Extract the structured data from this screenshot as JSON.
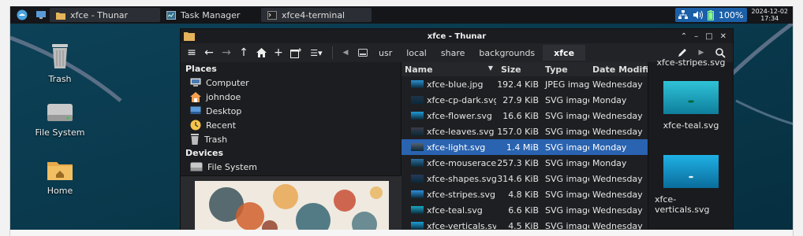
{
  "panel": {
    "tasks": [
      {
        "label": "xfce - Thunar",
        "icon": "folder-icon"
      },
      {
        "label": "Task Manager",
        "icon": "task-manager-icon"
      },
      {
        "label": "xfce4-terminal",
        "icon": "terminal-icon"
      }
    ],
    "battery": "100%",
    "date": "2024-12-02",
    "time": "17:34"
  },
  "desktop": {
    "icons": [
      {
        "label": "Trash",
        "icon": "trash-icon"
      },
      {
        "label": "File System",
        "icon": "drive-icon"
      },
      {
        "label": "Home",
        "icon": "home-folder-icon"
      }
    ]
  },
  "window": {
    "title": "xfce - Thunar",
    "breadcrumbs": [
      "usr",
      "local",
      "share",
      "backgrounds",
      "xfce"
    ],
    "active_crumb": "xfce"
  },
  "sidebar": {
    "places_heading": "Places",
    "places": [
      {
        "label": "Computer",
        "icon": "computer-icon"
      },
      {
        "label": "johndoe",
        "icon": "home-icon"
      },
      {
        "label": "Desktop",
        "icon": "desktop-icon"
      },
      {
        "label": "Recent",
        "icon": "recent-icon"
      },
      {
        "label": "Trash",
        "icon": "trash-icon"
      }
    ],
    "devices_heading": "Devices",
    "devices": [
      {
        "label": "File System",
        "icon": "drive-icon"
      }
    ]
  },
  "list": {
    "columns": [
      "Name",
      "Size",
      "Type",
      "Date Modified"
    ],
    "rows": [
      {
        "name": "xfce-blue.jpg",
        "size": "192.4 KiB",
        "type": "JPEG image",
        "date": "Wednesday",
        "color": "#2a8fd0"
      },
      {
        "name": "xfce-cp-dark.svg",
        "size": "27.9 KiB",
        "type": "SVG image",
        "date": "Monday",
        "color": "#1f3347"
      },
      {
        "name": "xfce-flower.svg",
        "size": "16.6 KiB",
        "type": "SVG image",
        "date": "Wednesday",
        "color": "#1e9bd6"
      },
      {
        "name": "xfce-leaves.svg",
        "size": "157.0 KiB",
        "type": "SVG image",
        "date": "Wednesday",
        "color": "#3b3b4a"
      },
      {
        "name": "xfce-light.svg",
        "size": "1.4 MiB",
        "type": "SVG image",
        "date": "Monday",
        "color": "#556070"
      },
      {
        "name": "xfce-mouserace.svg",
        "size": "257.3 KiB",
        "type": "SVG image",
        "date": "Monday",
        "color": "#2a6fa0"
      },
      {
        "name": "xfce-shapes.svg",
        "size": "314.6 KiB",
        "type": "SVG image",
        "date": "Wednesday",
        "color": "#243a5a"
      },
      {
        "name": "xfce-stripes.svg",
        "size": "4.8 KiB",
        "type": "SVG image",
        "date": "Wednesday",
        "color": "#2d8fe0"
      },
      {
        "name": "xfce-teal.svg",
        "size": "6.6 KiB",
        "type": "SVG image",
        "date": "Wednesday",
        "color": "#1ba7c4"
      },
      {
        "name": "xfce-verticals.svg",
        "size": "4.5 KiB",
        "type": "SVG image",
        "date": "Wednesday",
        "color": "#1aa0d8"
      }
    ],
    "selected_row": 4
  },
  "icon_view": {
    "items": [
      {
        "label": "xfce-stripes.svg",
        "color": "#2d8fe0"
      },
      {
        "label": "xfce-teal.svg",
        "color": "#1ba7c4"
      },
      {
        "label": "xfce-verticals.svg",
        "color": "#1a9ad0"
      }
    ]
  },
  "colors": {
    "selection": "#2a63b0",
    "tray_highlight": "#1b5fa8",
    "desktop_bg": "#0a3a4e"
  }
}
